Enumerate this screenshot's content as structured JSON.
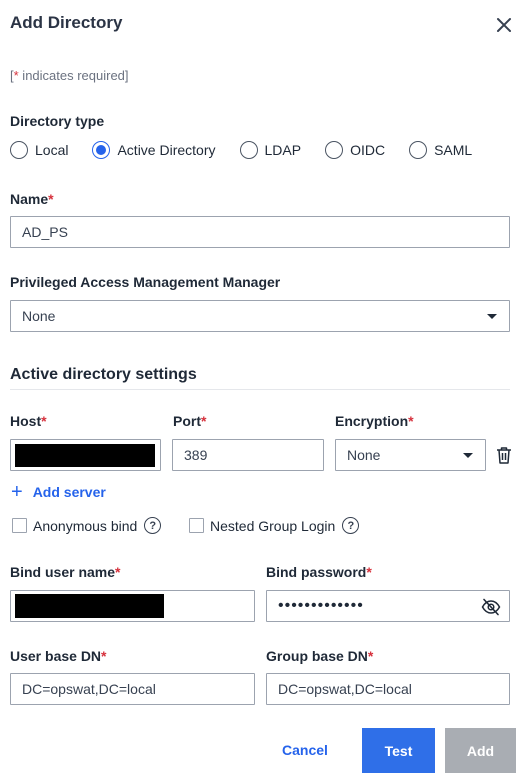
{
  "dialog": {
    "title": "Add Directory",
    "required_note_prefix": "[",
    "required_note_star": "*",
    "required_note_suffix": " indicates required]"
  },
  "directory_type": {
    "label": "Directory type",
    "options": [
      "Local",
      "Active Directory",
      "LDAP",
      "OIDC",
      "SAML"
    ],
    "selected": "Active Directory"
  },
  "name": {
    "label": "Name",
    "value": "AD_PS"
  },
  "pam": {
    "label": "Privileged Access Management Manager",
    "value": "None"
  },
  "ad_settings": {
    "section_title": "Active directory settings",
    "host_label": "Host",
    "port_label": "Port",
    "port_value": "389",
    "encryption_label": "Encryption",
    "encryption_value": "None",
    "add_server_label": "Add server",
    "anonymous_bind_label": "Anonymous bind",
    "anonymous_bind_checked": false,
    "nested_group_label": "Nested Group Login",
    "nested_group_checked": false,
    "bind_user_label": "Bind user name",
    "bind_password_label": "Bind password",
    "bind_password_mask": "•••••••••••••",
    "user_base_dn_label": "User base DN",
    "user_base_dn_value": "DC=opswat,DC=local",
    "group_base_dn_label": "Group base DN",
    "group_base_dn_value": "DC=opswat,DC=local"
  },
  "common": {
    "required_star": "*"
  },
  "footer": {
    "cancel_label": "Cancel",
    "test_label": "Test",
    "add_label": "Add"
  },
  "colors": {
    "accent": "#2f6fe8",
    "required": "#d6313c",
    "disabled": "#a9adb3"
  }
}
